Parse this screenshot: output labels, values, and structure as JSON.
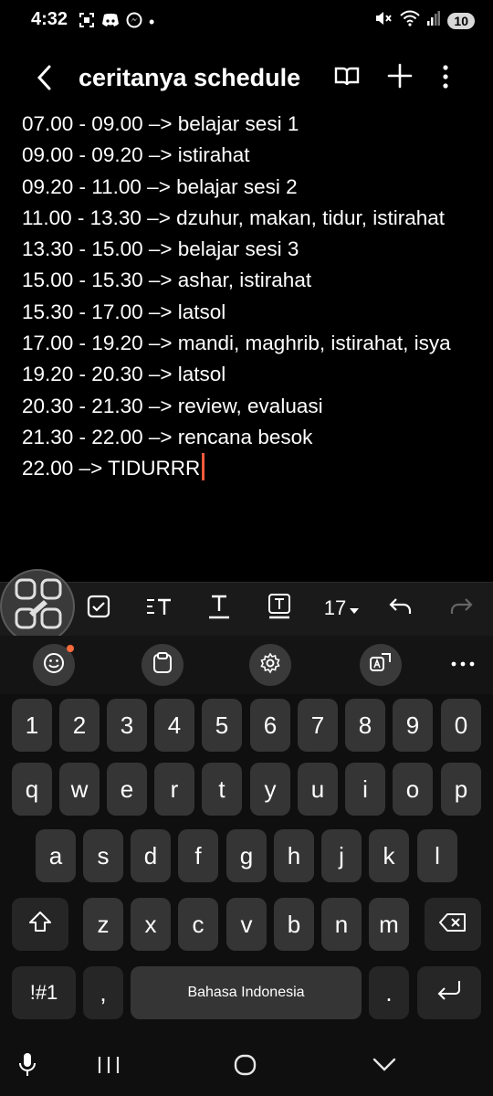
{
  "status_bar": {
    "time": "4:32",
    "dot": "•",
    "notification_count": "10"
  },
  "header": {
    "title": "ceritanya schedule"
  },
  "note": {
    "lines": [
      "07.00 - 09.00 –> belajar sesi 1",
      "09.00 - 09.20 –> istirahat",
      "09.20 - 11.00 –> belajar sesi 2",
      "11.00 - 13.30 –> dzuhur, makan, tidur, istirahat",
      "13.30 - 15.00 –> belajar sesi 3",
      "15.00 - 15.30 –> ashar, istirahat",
      "15.30 - 17.00 –> latsol",
      "17.00 - 19.20 –> mandi, maghrib, istirahat, isya",
      "19.20 - 20.30 –> latsol",
      "20.30 - 21.30 –> review, evaluasi",
      "21.30 - 22.00 –> rencana besok",
      "22.00 –> TIDURRR"
    ]
  },
  "toolbar": {
    "font_size": "17"
  },
  "keyboard": {
    "numbers": [
      "1",
      "2",
      "3",
      "4",
      "5",
      "6",
      "7",
      "8",
      "9",
      "0"
    ],
    "row1": [
      "q",
      "w",
      "e",
      "r",
      "t",
      "y",
      "u",
      "i",
      "o",
      "p"
    ],
    "row2": [
      "a",
      "s",
      "d",
      "f",
      "g",
      "h",
      "j",
      "k",
      "l"
    ],
    "row3": [
      "z",
      "x",
      "c",
      "v",
      "b",
      "n",
      "m"
    ],
    "symbols_label": "!#1",
    "comma": ",",
    "space_label": "Bahasa Indonesia",
    "period": "."
  },
  "colors": {
    "cursor": "#ff5a3c",
    "notification_dot": "#ff6a3c"
  }
}
